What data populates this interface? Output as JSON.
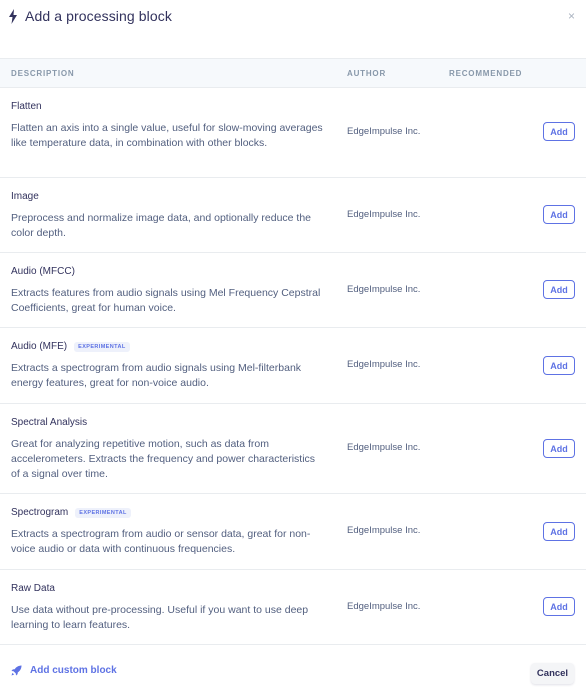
{
  "header": {
    "title": "Add a processing block",
    "icon": "bolt-icon",
    "close_label": "×"
  },
  "table": {
    "columns": [
      "DESCRIPTION",
      "AUTHOR",
      "RECOMMENDED"
    ],
    "rows": [
      {
        "name": "Flatten",
        "badge": "",
        "description": "Flatten an axis into a single value, useful for slow-moving averages like temperature data, in combination with other blocks.",
        "author": "EdgeImpulse Inc.",
        "action": "Add"
      },
      {
        "name": "Image",
        "badge": "",
        "description": "Preprocess and normalize image data, and optionally reduce the color depth.",
        "author": "EdgeImpulse Inc.",
        "action": "Add"
      },
      {
        "name": "Audio (MFCC)",
        "badge": "",
        "description": "Extracts features from audio signals using Mel Frequency Cepstral Coefficients, great for human voice.",
        "author": "EdgeImpulse Inc.",
        "action": "Add"
      },
      {
        "name": "Audio (MFE)",
        "badge": "EXPERIMENTAL",
        "description": "Extracts a spectrogram from audio signals using Mel-filterbank energy features, great for non-voice audio.",
        "author": "EdgeImpulse Inc.",
        "action": "Add"
      },
      {
        "name": "Spectral Analysis",
        "badge": "",
        "description": "Great for analyzing repetitive motion, such as data from accelerometers. Extracts the frequency and power characteristics of a signal over time.",
        "author": "EdgeImpulse Inc.",
        "action": "Add"
      },
      {
        "name": "Spectrogram",
        "badge": "EXPERIMENTAL",
        "description": "Extracts a spectrogram from audio or sensor data, great for non-voice audio or data with continuous frequencies.",
        "author": "EdgeImpulse Inc.",
        "action": "Add"
      },
      {
        "name": "Raw Data",
        "badge": "",
        "description": "Use data without pre-processing. Useful if you want to use deep learning to learn features.",
        "author": "EdgeImpulse Inc.",
        "action": "Add"
      }
    ]
  },
  "footer": {
    "custom_label": "Add custom block",
    "custom_icon": "rocket-icon",
    "cancel_label": "Cancel"
  },
  "colors": {
    "accent": "#5e72e4",
    "text": "#32325d",
    "muted": "#8898aa",
    "header_bg": "#f6f9fc"
  }
}
